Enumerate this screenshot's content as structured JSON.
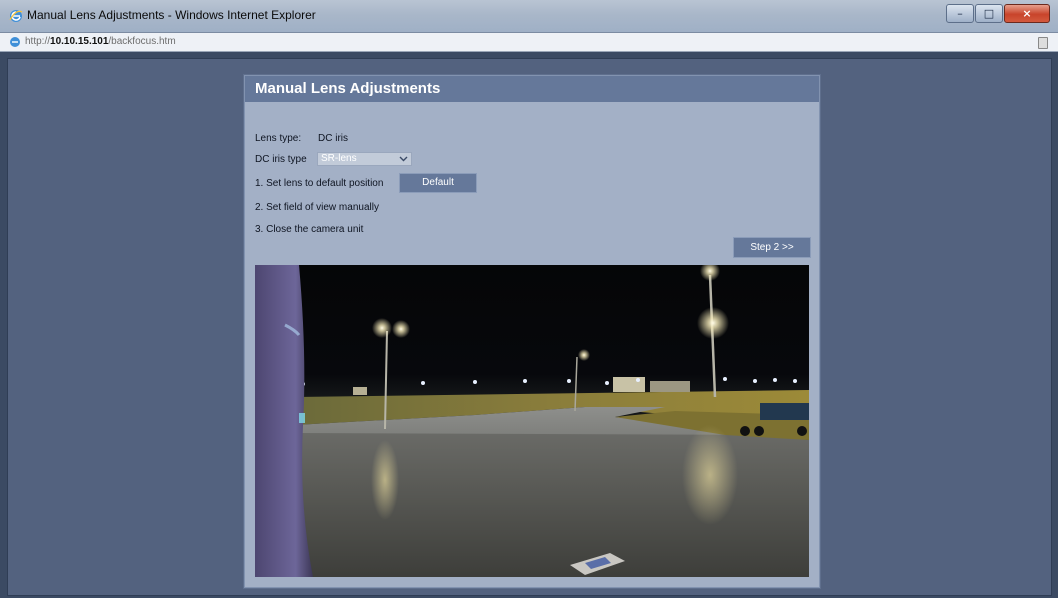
{
  "window": {
    "title": "Manual Lens Adjustments - Windows Internet Explorer",
    "controls": [
      "minimize",
      "maximize",
      "close"
    ]
  },
  "address": {
    "scheme": "http://",
    "host": "10.10.15.101",
    "path": "/backfocus.htm"
  },
  "icons": [
    "ie-icon",
    "lock-icon",
    "chevron-down-icon"
  ],
  "dialog": {
    "title": "Manual Lens Adjustments",
    "lens_type_label": "Lens type:",
    "lens_type_value": "DC iris",
    "iris_type_label": "DC iris type",
    "iris_type_value": "SR-lens",
    "step1": "1. Set lens to default position",
    "default_button": "Default",
    "step2": "2. Set field of view manually",
    "step3": "3. Close the camera unit",
    "next_button": "Step 2 >>"
  },
  "colors": {
    "page_background": "#53627f",
    "dialog_header": "#65789a",
    "dialog_body": "#a3b0c6",
    "button": "#65789a"
  }
}
